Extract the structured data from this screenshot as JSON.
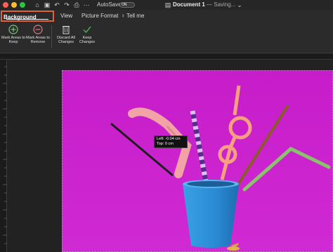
{
  "titlebar": {
    "autosave_label": "AutoSave",
    "autosave_state": "ON",
    "doc_title": "Document 1",
    "doc_status": "— Saving...",
    "icons": [
      "home-icon",
      "save-icon",
      "undo-icon",
      "redo-icon",
      "print-icon",
      "more-icon",
      "chevron-down-icon"
    ]
  },
  "tabs": {
    "active": "Background Removal",
    "view": "View",
    "picture_format": "Picture Format",
    "tell_me": "Tell me"
  },
  "toolbar": {
    "mark_keep": "Mark Areas to Keep",
    "mark_remove": "Mark Areas to Remove",
    "discard": "Discard All Changes",
    "keep": "Keep Changes"
  },
  "tooltip": {
    "left": "Left: -0.04 cm",
    "top": "Top: 0 cm"
  },
  "colors": {
    "accent": "#e0623a",
    "background": "#cc1fcf",
    "cup": "#2e8fd6"
  }
}
